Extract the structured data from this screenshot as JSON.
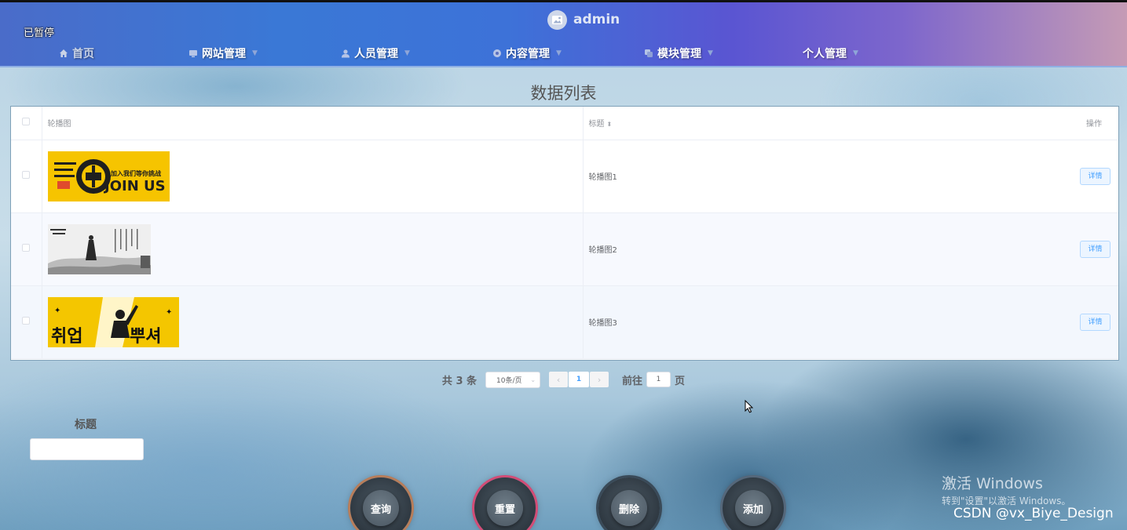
{
  "header": {
    "paused_text": "已暂停",
    "username": "admin",
    "nav": [
      {
        "label": "首页",
        "icon": "home-icon",
        "has_caret": false
      },
      {
        "label": "网站管理",
        "icon": "monitor-icon",
        "has_caret": true
      },
      {
        "label": "人员管理",
        "icon": "user-icon",
        "has_caret": true
      },
      {
        "label": "内容管理",
        "icon": "content-icon",
        "has_caret": true
      },
      {
        "label": "模块管理",
        "icon": "module-icon",
        "has_caret": true
      },
      {
        "label": "个人管理",
        "icon": "",
        "has_caret": true
      }
    ]
  },
  "page_title": "数据列表",
  "table": {
    "columns": [
      "轮播图",
      "标题",
      "操作"
    ],
    "rows": [
      {
        "title": "轮播图1",
        "action": "详情",
        "image": {
          "description": "join-us-banner",
          "texts": [
            "加入我们",
            "等你挑战",
            "JOIN US"
          ]
        }
      },
      {
        "title": "轮播图2",
        "action": "详情",
        "image": {
          "description": "ink-painting-banner"
        }
      },
      {
        "title": "轮播图3",
        "action": "详情",
        "image": {
          "description": "yellow-recruit-banner",
          "texts": [
            "취업",
            "뿌셔"
          ]
        }
      }
    ]
  },
  "pagination": {
    "total_text": "共 3 条",
    "page_size": "10条/页",
    "prev": "‹",
    "current_page": "1",
    "next": "›",
    "goto_label": "前往",
    "goto_value": "1",
    "page_suffix": "页"
  },
  "search": {
    "label": "标题",
    "value": ""
  },
  "actions": {
    "query": "查询",
    "reset": "重置",
    "delete": "删除",
    "add": "添加"
  },
  "overlay": {
    "activate_title": "激活 Windows",
    "activate_sub": "转到\"设置\"以激活 Windows。",
    "watermark": "CSDN @vx_Biye_Design"
  },
  "colors": {
    "accent": "#409eff",
    "header_start": "#4a6cc9",
    "header_end": "#c59bb5"
  }
}
